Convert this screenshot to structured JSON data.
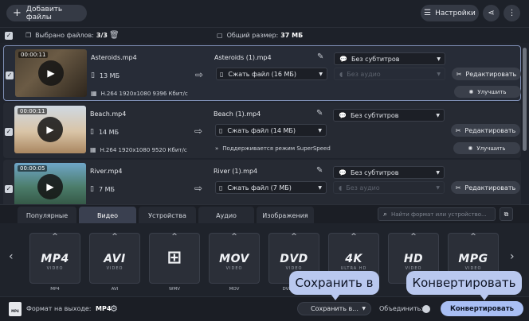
{
  "topbar": {
    "add_files": "Добавить файлы",
    "settings": "Настройки"
  },
  "selection": {
    "selected_label": "Выбрано файлов:",
    "selected_value": "3/3",
    "total_label": "Общий размер:",
    "total_value": "37 МБ"
  },
  "files": [
    {
      "duration": "00:00:11",
      "name": "Asteroids.mp4",
      "size": "13 МБ",
      "codec": "H.264 1920x1080 9396 Кбит/с",
      "output_name": "Asteroids (1).mp4",
      "compress": "Сжать файл (16 МБ)",
      "subtitles": "Без субтитров",
      "audio": "Без аудио",
      "edit": "Редактировать",
      "improve": "Улучшить",
      "note": ""
    },
    {
      "duration": "00:00:11",
      "name": "Beach.mp4",
      "size": "14 МБ",
      "codec": "H.264 1920x1080 9520 Кбит/с",
      "output_name": "Beach (1).mp4",
      "compress": "Сжать файл (14 МБ)",
      "subtitles": "Без субтитров",
      "audio": "",
      "edit": "Редактировать",
      "improve": "Улучшить",
      "note": "Поддерживается режим SuperSpeed"
    },
    {
      "duration": "00:00:05",
      "name": "River.mp4",
      "size": "7 МБ",
      "codec": "",
      "output_name": "River (1).mp4",
      "compress": "Сжать файл (7 МБ)",
      "subtitles": "Без субтитров",
      "audio": "Без аудио",
      "edit": "Редактировать",
      "improve": "",
      "note": ""
    }
  ],
  "tabs": [
    "Популярные",
    "Видео",
    "Устройства",
    "Аудио",
    "Изображения"
  ],
  "search": {
    "placeholder": "Найти формат или устройство..."
  },
  "formats": [
    {
      "logo": "MP4",
      "sub": "VIDEO",
      "label": "MP4"
    },
    {
      "logo": "AVI",
      "sub": "VIDEO",
      "label": "AVI"
    },
    {
      "logo": "⊞",
      "sub": "",
      "label": "WMV"
    },
    {
      "logo": "MOV",
      "sub": "VIDEO",
      "label": "MOV"
    },
    {
      "logo": "DVD",
      "sub": "VIDEO",
      "label": "DVD-сов..."
    },
    {
      "logo": "4K",
      "sub": "ULTRA HD",
      "label": ""
    },
    {
      "logo": "HD",
      "sub": "VIDEO",
      "label": "HD"
    },
    {
      "logo": "MPG",
      "sub": "VIDEO",
      "label": ""
    }
  ],
  "bottom": {
    "format_icon": "MP4",
    "output_label": "Формат на выходе:",
    "output_value": "MP4",
    "save_to": "Сохранить в...",
    "merge": "Объединить:",
    "convert": "Конвертировать"
  },
  "callouts": {
    "save": "Сохранить в",
    "convert": "Конвертировать"
  },
  "colors": {
    "background": "#1f232c",
    "accent": "#a9bff4",
    "callout": "#b9c8ef",
    "active_border": "#7e8eb4"
  }
}
